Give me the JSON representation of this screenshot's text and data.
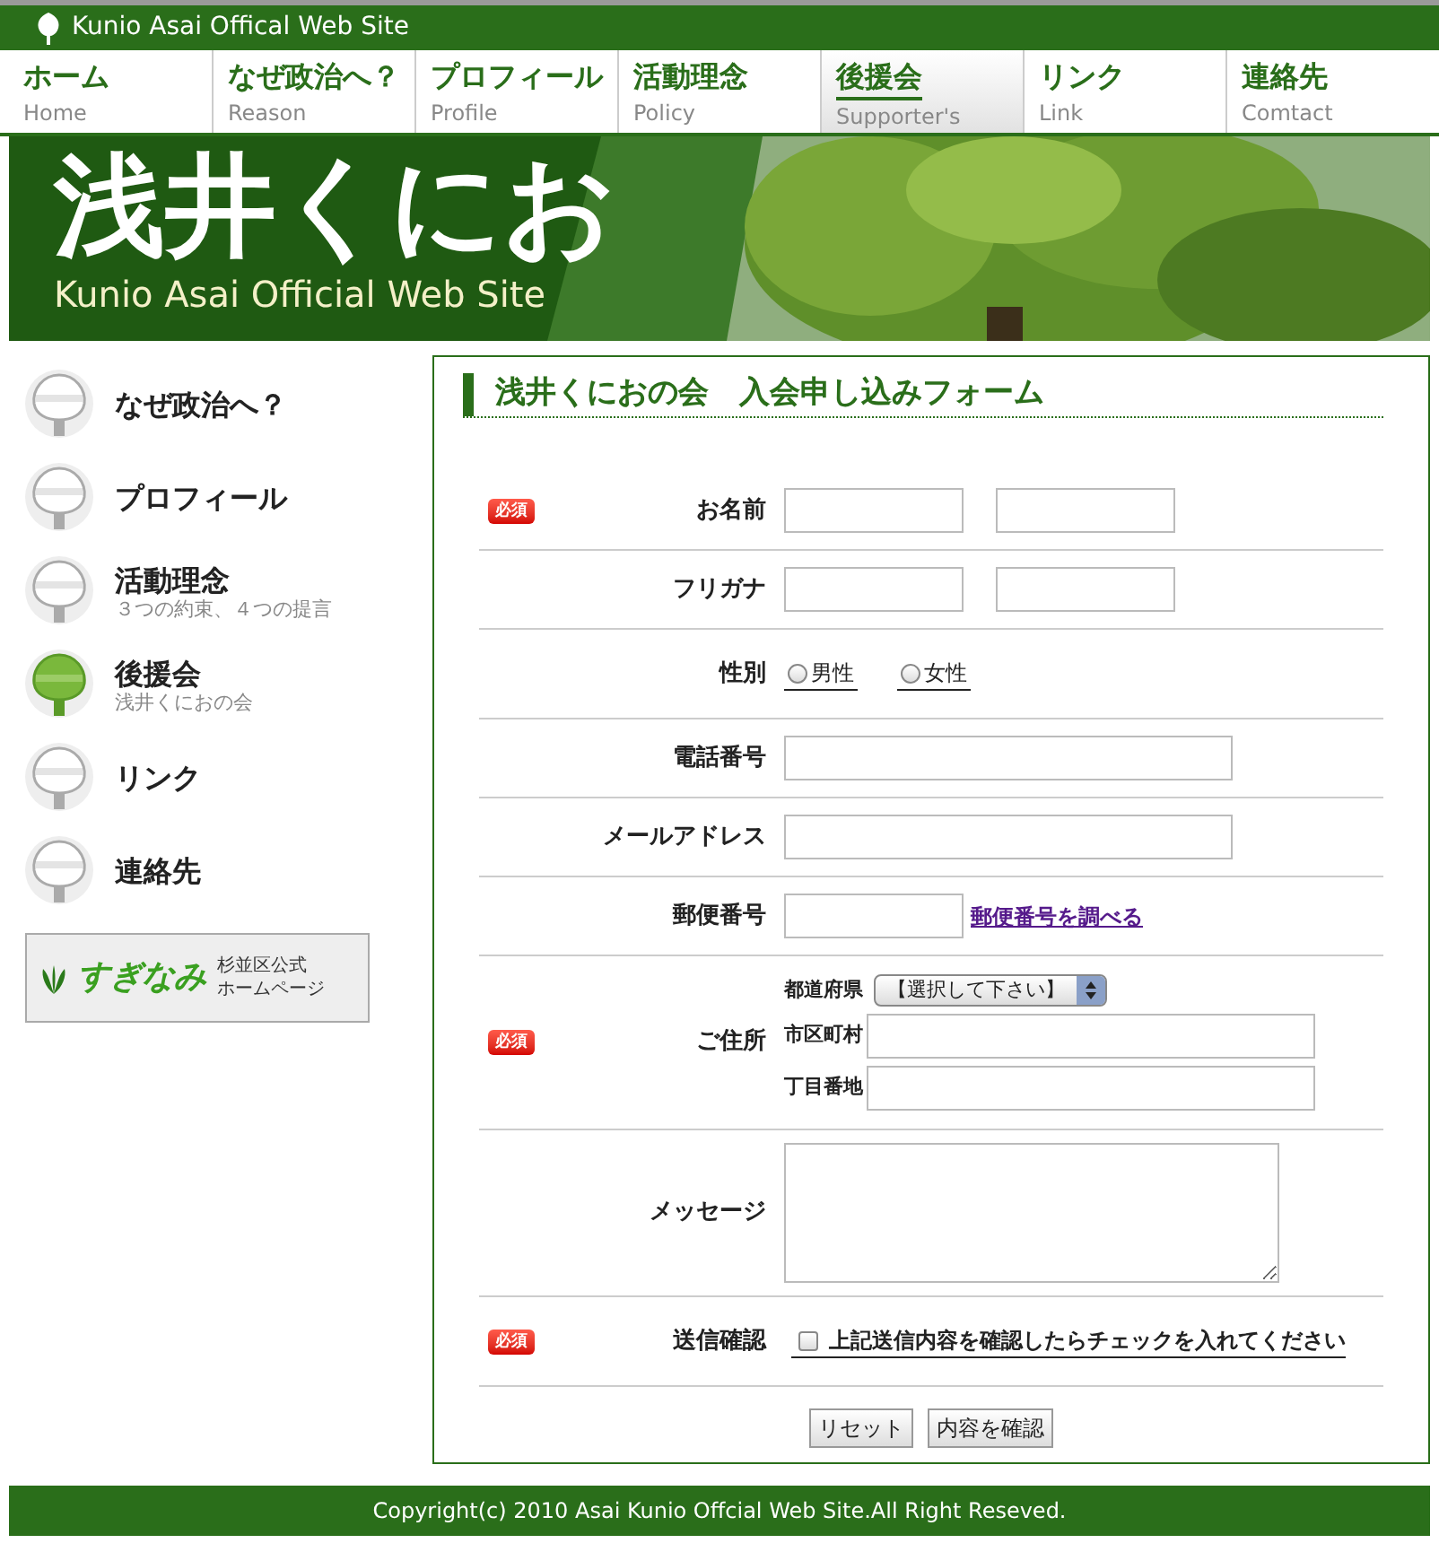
{
  "site_header": {
    "title": "Kunio Asai Offical Web Site"
  },
  "nav": [
    {
      "label": "ホーム",
      "sublabel": "Home",
      "selected": false
    },
    {
      "label": "なぜ政治へ？",
      "sublabel": "Reason",
      "selected": false
    },
    {
      "label": "プロフィール",
      "sublabel": "Profile",
      "selected": false
    },
    {
      "label": "活動理念",
      "sublabel": "Policy",
      "selected": false
    },
    {
      "label": "後援会",
      "sublabel": "Supporter's",
      "selected": true
    },
    {
      "label": "リンク",
      "sublabel": "Link",
      "selected": false
    },
    {
      "label": "連絡先",
      "sublabel": "Comtact",
      "selected": false
    }
  ],
  "banner": {
    "title": "浅井くにお",
    "subtitle": "Kunio Asai Official Web Site"
  },
  "sidebar": {
    "items": [
      {
        "label": "なぜ政治へ？",
        "selected": false
      },
      {
        "label": "プロフィール",
        "selected": false
      },
      {
        "label": "活動理念",
        "sublabel": "３つの約束、４つの提言",
        "selected": false
      },
      {
        "label": "後援会",
        "sublabel": "浅井くにおの会",
        "selected": true
      },
      {
        "label": "リンク",
        "selected": false
      },
      {
        "label": "連絡先",
        "selected": false
      }
    ],
    "ward_banner": {
      "logo_text": "すぎなみ",
      "caption": [
        "杉並区公式",
        "ホームページ"
      ]
    }
  },
  "form": {
    "title": "浅井くにおの会　入会申し込みフォーム",
    "rows": [
      {
        "kind": "pair",
        "label": "お名前",
        "badge": "必須"
      },
      {
        "kind": "pair",
        "label": "フリガナ"
      },
      {
        "kind": "radio",
        "label": "性別",
        "options": [
          {
            "label": "男性",
            "selected": false
          },
          {
            "label": "女性",
            "selected": false
          }
        ]
      },
      {
        "kind": "text",
        "label": "電話番号"
      },
      {
        "kind": "text",
        "label": "メールアドレス"
      },
      {
        "kind": "postal",
        "label": "郵便番号",
        "link": "郵便番号を調べる"
      },
      {
        "kind": "address",
        "label": "ご住所",
        "badge": "必須",
        "fields": [
          {
            "kind": "select",
            "label": "都道府県",
            "value": "【選択して下さい】"
          },
          {
            "kind": "text",
            "label": "市区町村"
          },
          {
            "kind": "text",
            "label": "丁目番地"
          }
        ]
      },
      {
        "kind": "textarea",
        "label": "メッセージ"
      },
      {
        "kind": "checkbox",
        "label": "送信確認",
        "badge": "必須",
        "text": "上記送信内容を確認したらチェックを入れてください",
        "checked": false
      }
    ],
    "buttons": [
      "リセット",
      "内容を確認"
    ]
  },
  "footer": {
    "text": "Copyright(c) 2010 Asai Kunio Offcial Web Site.All Right Reseved."
  }
}
